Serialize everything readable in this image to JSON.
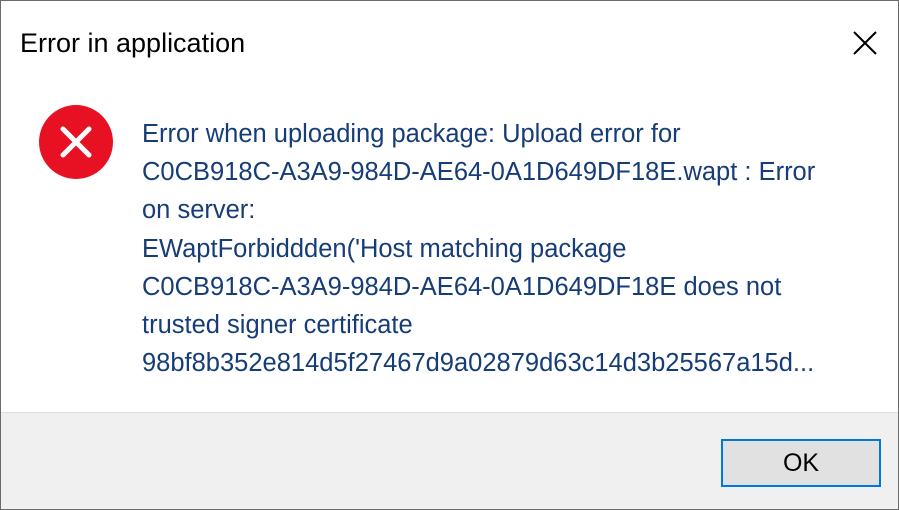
{
  "dialog": {
    "title": "Error in application",
    "close_icon": "close-icon",
    "error_icon": "error-icon",
    "error_icon_color": "#e81123",
    "message": "Error when uploading package: Upload error for\nC0CB918C-A3A9-984D-AE64-0A1D649DF18E.wapt : Error\non server:\nEWaptForbiddden('Host matching package\nC0CB918C-A3A9-984D-AE64-0A1D649DF18E does not\ntrusted signer certificate\n98bf8b352e814d5f27467d9a02879d63c14d3b25567a15d...",
    "message_color": "#163d77",
    "ok_label": "OK",
    "ok_border_color": "#0078d7"
  }
}
